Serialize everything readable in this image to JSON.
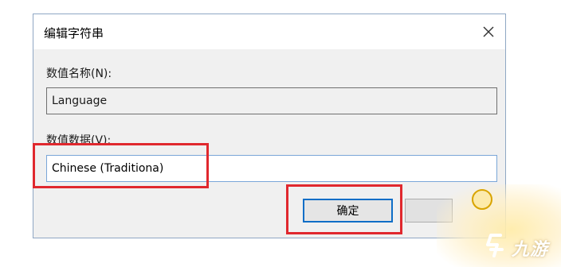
{
  "dialog": {
    "title": "编辑字符串",
    "close_glyph": "✕"
  },
  "value_name": {
    "label": "数值名称(N):",
    "value": "Language"
  },
  "value_data": {
    "label": "数值数据(V):",
    "value": "Chinese (Traditiona)"
  },
  "buttons": {
    "ok_label": "确定"
  },
  "watermark": {
    "text": "九游",
    "icon": "jiuyou-logo-icon"
  },
  "colors": {
    "highlight": "#e0282e",
    "focus_border": "#0f6ec7",
    "dialog_bg": "#f0f0f0"
  }
}
